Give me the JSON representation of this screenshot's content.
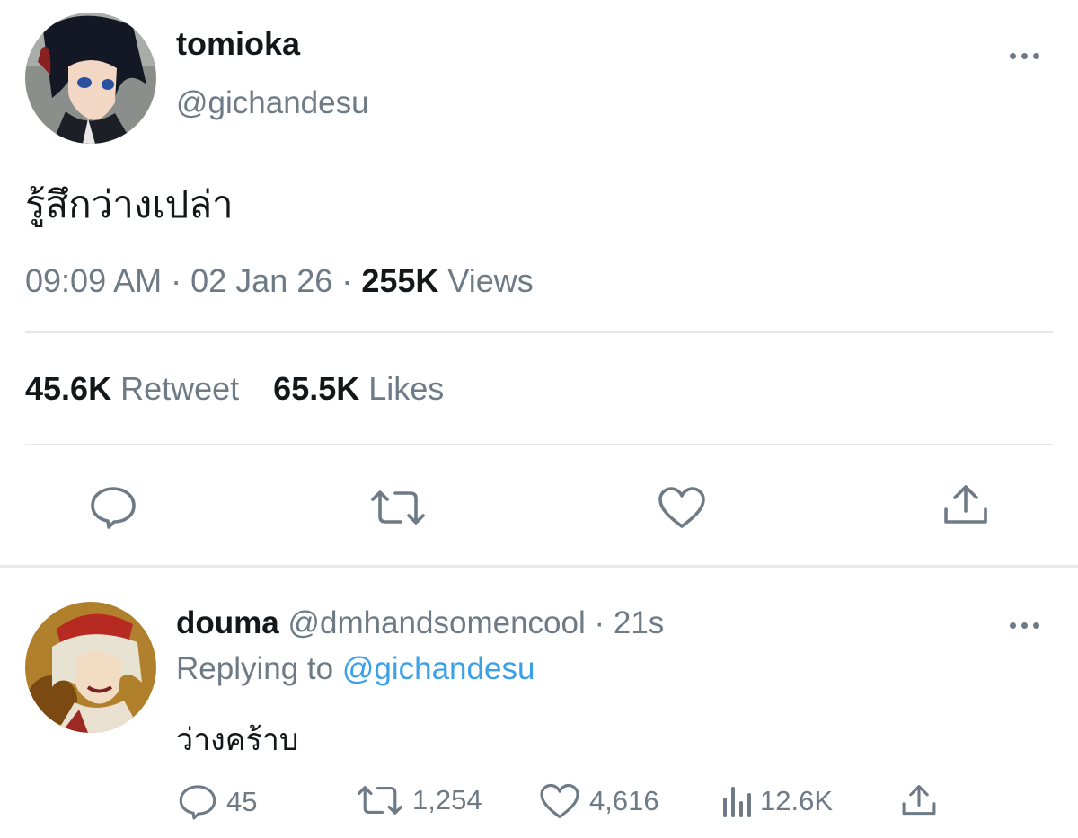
{
  "main_tweet": {
    "display_name": "tomioka",
    "handle": "@gichandesu",
    "text": "รู้สึกว่างเปล่า",
    "time": "09:09 AM",
    "date": "02 Jan 26",
    "separator": "·",
    "views_count": "255K",
    "views_label": "Views",
    "retweets_count": "45.6K",
    "retweets_label": "Retweet",
    "likes_count": "65.5K",
    "likes_label": "Likes"
  },
  "reply": {
    "display_name": "douma",
    "handle": "@dmhandsomencool",
    "separator": "·",
    "time_ago": "21s",
    "replying_prefix": "Replying to",
    "replying_handle": "@gichandesu",
    "text": "ว่างคร้าบ",
    "replies": "45",
    "retweets": "1,254",
    "likes": "4,616",
    "views": "12.6K"
  },
  "icons": {
    "more": "more-horizontal-icon",
    "reply": "reply-bubble-icon",
    "retweet": "retweet-icon",
    "like": "heart-icon",
    "share": "share-icon",
    "views": "analytics-icon"
  },
  "colors": {
    "text": "#14171a",
    "muted": "#6e7a85",
    "link": "#3aa0e8",
    "divider": "#e3e7ea"
  }
}
